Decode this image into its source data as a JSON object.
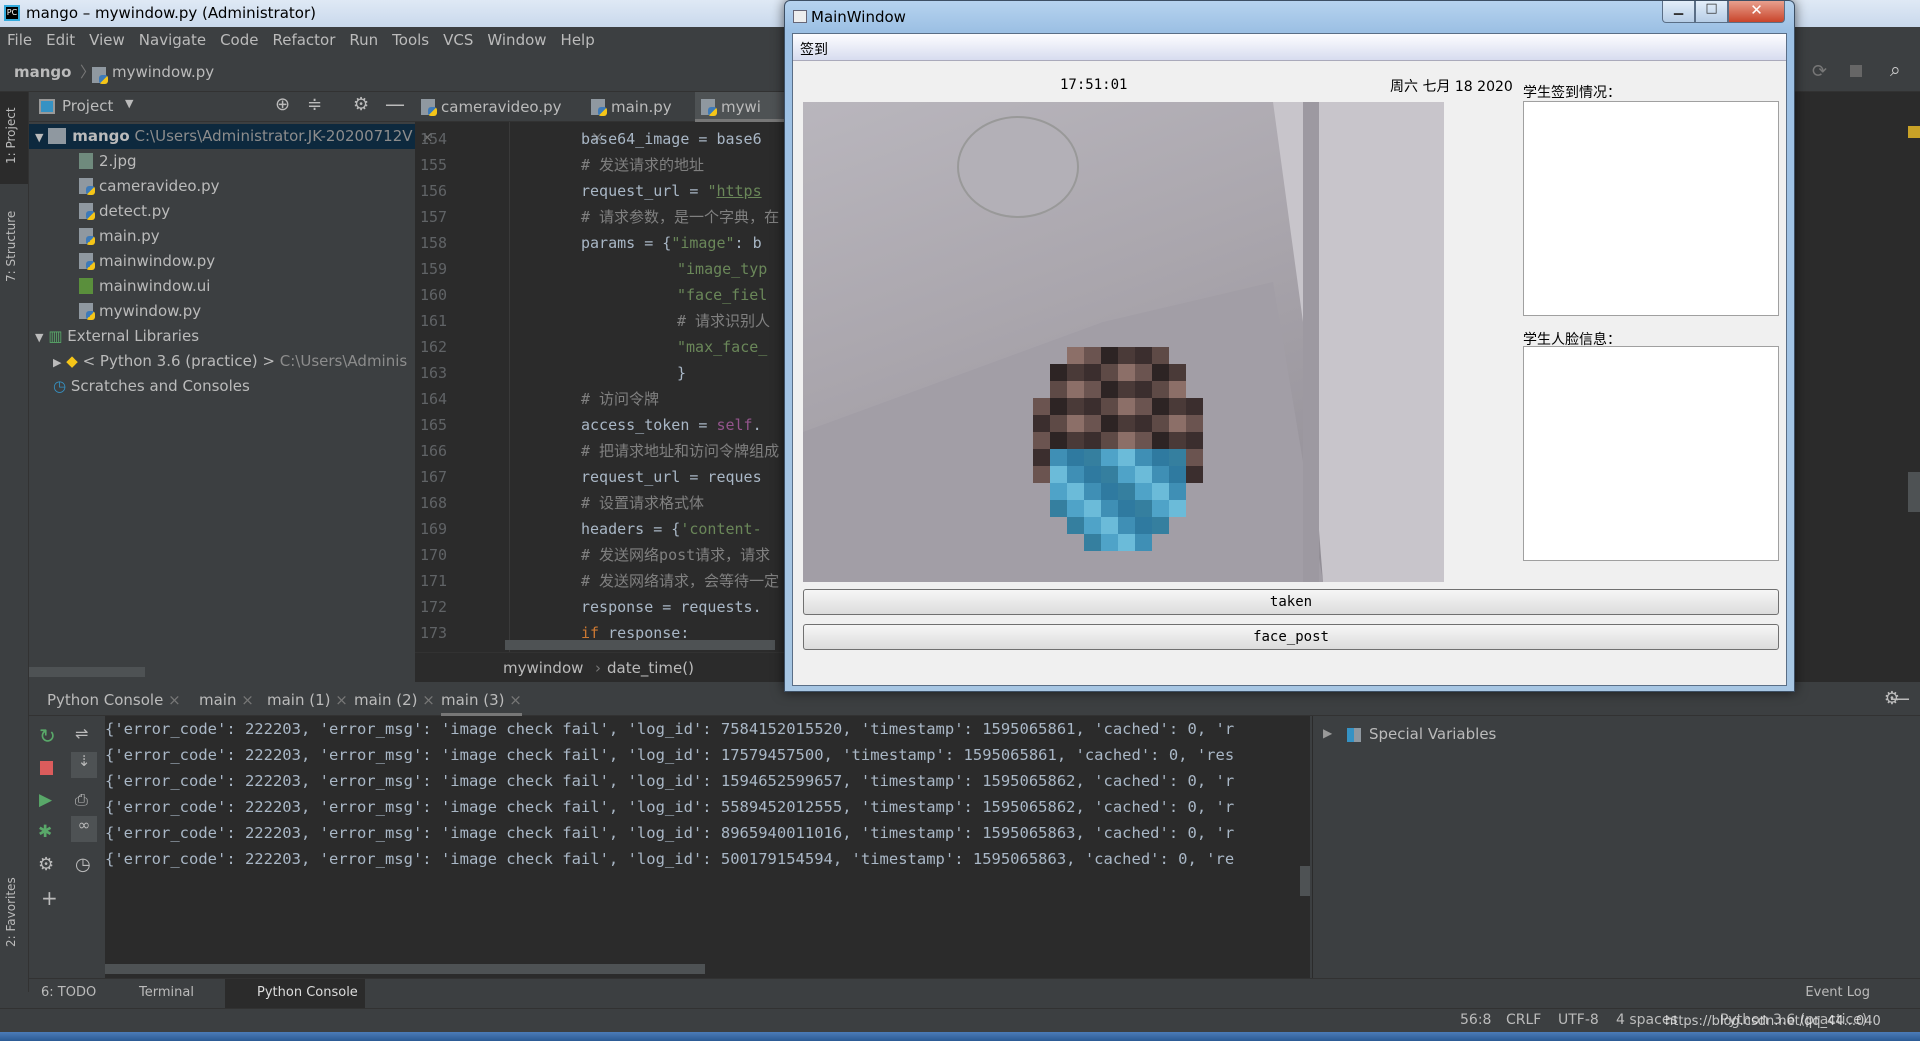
{
  "ide": {
    "title": "mango – mywindow.py (Administrator)",
    "menu": [
      "File",
      "Edit",
      "View",
      "Navigate",
      "Code",
      "Refactor",
      "Run",
      "Tools",
      "VCS",
      "Window",
      "Help"
    ],
    "breadcrumb": {
      "project": "mango",
      "file": "mywindow.py"
    },
    "left_tabs": [
      "1: Project",
      "7: Structure",
      "2: Favorites"
    ],
    "project_panel": {
      "title": "Project",
      "root": {
        "name": "mango",
        "path": "C:\\Users\\Administrator.JK-20200712V"
      },
      "files": [
        {
          "name": "2.jpg",
          "type": "img"
        },
        {
          "name": "cameravideo.py",
          "type": "py"
        },
        {
          "name": "detect.py",
          "type": "py"
        },
        {
          "name": "main.py",
          "type": "py"
        },
        {
          "name": "mainwindow.py",
          "type": "py"
        },
        {
          "name": "mainwindow.ui",
          "type": "qt"
        },
        {
          "name": "mywindow.py",
          "type": "py"
        }
      ],
      "external": "External Libraries",
      "python_lib": {
        "name": "< Python 3.6 (practice) >",
        "path": "C:\\Users\\Adminis"
      },
      "scratches": "Scratches and Consoles"
    },
    "editor_tabs": [
      "cameravideo.py",
      "main.py",
      "mywi"
    ],
    "code": [
      {
        "n": "154",
        "seg": [
          [
            "nm",
            "base64_image = base6"
          ]
        ],
        "ind": 0
      },
      {
        "n": "155",
        "seg": [
          [
            "cm",
            "# 发送请求的地址"
          ]
        ],
        "ind": 0
      },
      {
        "n": "156",
        "seg": [
          [
            "nm",
            "request_url = "
          ],
          [
            "st",
            "\""
          ],
          [
            "st ul",
            "https"
          ]
        ],
        "ind": 0
      },
      {
        "n": "157",
        "seg": [
          [
            "cm",
            "# 请求参数，是一个字典，在"
          ]
        ],
        "ind": 0
      },
      {
        "n": "158",
        "seg": [
          [
            "nm",
            "params = {"
          ],
          [
            "st",
            "\"image\""
          ],
          [
            "nm",
            ": b"
          ]
        ],
        "ind": 0
      },
      {
        "n": "159",
        "seg": [
          [
            "st",
            "\"image_typ"
          ]
        ],
        "ind": 1
      },
      {
        "n": "160",
        "seg": [
          [
            "st",
            "\"face_fiel"
          ]
        ],
        "ind": 1
      },
      {
        "n": "161",
        "seg": [
          [
            "cm",
            "# 请求识别人"
          ]
        ],
        "ind": 1
      },
      {
        "n": "162",
        "seg": [
          [
            "st",
            "\"max_face_"
          ]
        ],
        "ind": 1
      },
      {
        "n": "163",
        "seg": [
          [
            "nm",
            "}"
          ]
        ],
        "ind": 1
      },
      {
        "n": "164",
        "seg": [
          [
            "cm",
            "# 访问令牌"
          ]
        ],
        "ind": 0
      },
      {
        "n": "165",
        "seg": [
          [
            "nm",
            "access_token = "
          ],
          [
            "sf",
            "self"
          ],
          [
            "nm",
            "."
          ]
        ],
        "ind": 0
      },
      {
        "n": "166",
        "seg": [
          [
            "cm",
            "# 把请求地址和访问令牌组成"
          ]
        ],
        "ind": 0
      },
      {
        "n": "167",
        "seg": [
          [
            "nm",
            "request_url = reques"
          ]
        ],
        "ind": 0
      },
      {
        "n": "168",
        "seg": [
          [
            "cm",
            "# 设置请求格式体"
          ]
        ],
        "ind": 0
      },
      {
        "n": "169",
        "seg": [
          [
            "nm",
            "headers = {"
          ],
          [
            "st",
            "'content-"
          ]
        ],
        "ind": 0
      },
      {
        "n": "170",
        "seg": [
          [
            "cm",
            "# 发送网络post请求，请求"
          ]
        ],
        "ind": 0
      },
      {
        "n": "171",
        "seg": [
          [
            "cm",
            "# 发送网络请求，会等待一定"
          ]
        ],
        "ind": 0
      },
      {
        "n": "172",
        "seg": [
          [
            "nm",
            "response = requests."
          ]
        ],
        "ind": 0
      },
      {
        "n": "173",
        "seg": [
          [
            "kw",
            "if "
          ],
          [
            "nm",
            "response:"
          ]
        ],
        "ind": 0
      }
    ],
    "editor_breadcrumb": [
      "mywindow",
      "date_time()"
    ],
    "console_tabs": [
      "Python Console",
      "main",
      "main (1)",
      "main (2)",
      "main (3)"
    ],
    "console_lines": [
      "{'error_code': 222203, 'error_msg': 'image check fail', 'log_id': 7584152015520, 'timestamp': 1595065861, 'cached': 0, 'r",
      "{'error_code': 222203, 'error_msg': 'image check fail', 'log_id': 17579457500, 'timestamp': 1595065861, 'cached': 0, 'res",
      "{'error_code': 222203, 'error_msg': 'image check fail', 'log_id': 1594652599657, 'timestamp': 1595065862, 'cached': 0, 'r",
      "{'error_code': 222203, 'error_msg': 'image check fail', 'log_id': 5589452012555, 'timestamp': 1595065862, 'cached': 0, 'r",
      "{'error_code': 222203, 'error_msg': 'image check fail', 'log_id': 8965940011016, 'timestamp': 1595065863, 'cached': 0, 'r",
      "{'error_code': 222203, 'error_msg': 'image check fail', 'log_id': 500179154594, 'timestamp': 1595065863, 'cached': 0, 're"
    ],
    "special_variables": "Special Variables",
    "bottom_tools": [
      "6: TODO",
      "Terminal",
      "Python Console"
    ],
    "event_log": "Event Log",
    "status": {
      "position": "56:8",
      "line_sep": "CRLF",
      "encoding": "UTF-8",
      "indent": "4 spaces",
      "interpreter": "Python 3.6 (practice)",
      "watermark": "https://blog.csdn.net/qq_44...040"
    }
  },
  "main_window": {
    "title": "MainWindow",
    "menu": "签到",
    "time": "17:51:01",
    "date": "周六 七月 18 2020",
    "sign_label": "学生签到情况：",
    "face_label": "学生人脸信息：",
    "btn_taken": "taken",
    "btn_face_post": "face_post"
  }
}
